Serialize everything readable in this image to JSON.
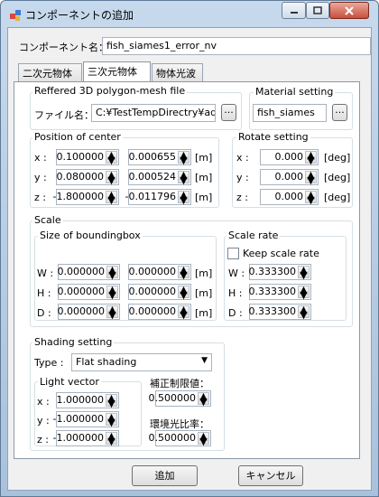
{
  "window": {
    "title": "コンポーネントの追加"
  },
  "component": {
    "name_label": "コンポーネント名：",
    "name_value": "fish_siames1_error_nv"
  },
  "tabs": [
    {
      "label": "二次元物体"
    },
    {
      "label": "三次元物体",
      "selected": true
    },
    {
      "label": "物体光波"
    }
  ],
  "polygon_file": {
    "title": "Reffered 3D polygon-mesh file",
    "file_label": "ファイル名：",
    "file_value": "C:¥TestTempDirectry¥aqu",
    "browse_label": "..."
  },
  "material": {
    "title": "Material setting",
    "value": "fish_siames",
    "browse_label": "..."
  },
  "position": {
    "title": "Position of center",
    "unit": "[m]",
    "rows": [
      {
        "label": "x :",
        "value1": "0.100000",
        "value2": "0.000655"
      },
      {
        "label": "y :",
        "value1": "0.080000",
        "value2": "0.000524"
      },
      {
        "label": "z :",
        "value1": "-1.800000",
        "value2": "-0.011796"
      }
    ]
  },
  "rotate": {
    "title": "Rotate setting",
    "unit": "[deg]",
    "rows": [
      {
        "label": "x :",
        "value": "0.000"
      },
      {
        "label": "y :",
        "value": "0.000"
      },
      {
        "label": "z :",
        "value": "0.000"
      }
    ]
  },
  "scale": {
    "title": "Scale",
    "bbox": {
      "title": "Size of boundingbox",
      "unit": "[m]",
      "rows": [
        {
          "label": "W :",
          "value1": "0.000000",
          "value2": "0.000000"
        },
        {
          "label": "H :",
          "value1": "0.000000",
          "value2": "0.000000"
        },
        {
          "label": "D :",
          "value1": "0.000000",
          "value2": "0.000000"
        }
      ]
    },
    "rate": {
      "title": "Scale rate",
      "keep_label": "Keep scale rate",
      "keep_checked": false,
      "rows": [
        {
          "label": "W :",
          "value": "0.333300"
        },
        {
          "label": "H :",
          "value": "0.333300"
        },
        {
          "label": "D :",
          "value": "0.333300"
        }
      ]
    }
  },
  "shading": {
    "title": "Shading setting",
    "type_label": "Type :",
    "type_value": "Flat shading",
    "light": {
      "title": "Light vector",
      "rows": [
        {
          "label": "x :",
          "value": "1.000000"
        },
        {
          "label": "y :",
          "value": "-1.000000"
        },
        {
          "label": "z :",
          "value": "-1.000000"
        }
      ]
    },
    "correction_label": "補正制限値：",
    "correction_value": "0.500000",
    "ambient_label": "環境光比率：",
    "ambient_value": "0.500000"
  },
  "buttons": {
    "add": "追加",
    "cancel": "キャンセル"
  }
}
